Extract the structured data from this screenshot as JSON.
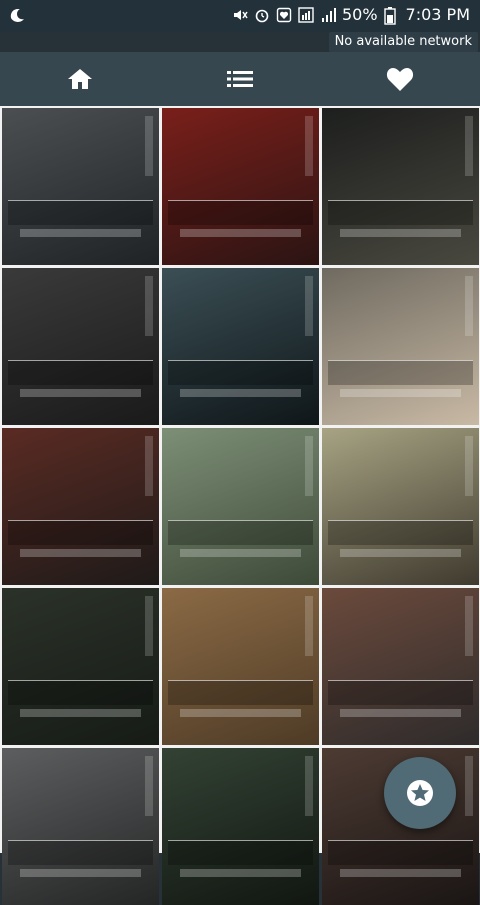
{
  "status": {
    "battery": "50%",
    "time": "7:03 PM",
    "network_notice": "No available network",
    "icons": [
      "app-notification-icon",
      "mute-icon",
      "alarm-icon",
      "do-not-disturb-icon",
      "sim-icon",
      "signal-icon",
      "battery-icon"
    ]
  },
  "toolbar": {
    "tabs": [
      {
        "name": "home",
        "icon": "home-icon"
      },
      {
        "name": "list",
        "icon": "list-icon"
      },
      {
        "name": "favorites",
        "icon": "heart-icon"
      }
    ]
  },
  "grid": {
    "columns": 3,
    "tiles": [
      {
        "colors": [
          "#4b4f52",
          "#1f2326"
        ]
      },
      {
        "colors": [
          "#7a1f1a",
          "#2a1413"
        ]
      },
      {
        "colors": [
          "#1d1f1e",
          "#49483f"
        ]
      },
      {
        "colors": [
          "#3a3a3a",
          "#1a1a1a"
        ]
      },
      {
        "colors": [
          "#3b4f55",
          "#0f1619"
        ]
      },
      {
        "colors": [
          "#6f6a60",
          "#c8b9a4"
        ]
      },
      {
        "colors": [
          "#5a2b23",
          "#1e1a19"
        ]
      },
      {
        "colors": [
          "#7d8f77",
          "#3e4a38"
        ]
      },
      {
        "colors": [
          "#a7a383",
          "#3f3a2e"
        ]
      },
      {
        "colors": [
          "#2b3229",
          "#161b16"
        ]
      },
      {
        "colors": [
          "#8b6a45",
          "#4e3b26"
        ]
      },
      {
        "colors": [
          "#6b4a3c",
          "#2e2b2b"
        ]
      },
      {
        "colors": [
          "#5d5e5f",
          "#242626"
        ]
      },
      {
        "colors": [
          "#334234",
          "#111611"
        ]
      },
      {
        "colors": [
          "#4d3b33",
          "#1a1514"
        ]
      }
    ]
  },
  "fab": {
    "icon": "star-icon"
  },
  "colors": {
    "toolbar": "#36474f",
    "statusbar": "#22313a",
    "fab": "#506a76"
  }
}
